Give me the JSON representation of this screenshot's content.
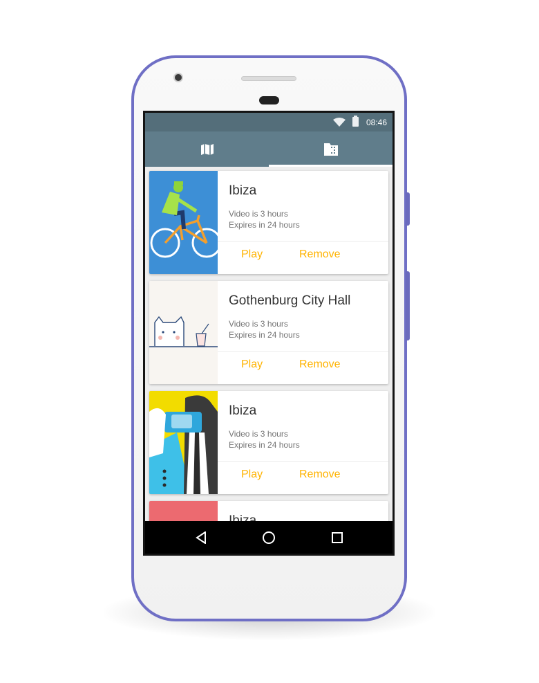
{
  "statusbar": {
    "time": "08:46",
    "wifi_icon": "wifi-icon",
    "battery_icon": "battery-icon"
  },
  "tabs": [
    {
      "icon": "map-icon",
      "selected": false
    },
    {
      "icon": "film-folder-icon",
      "selected": true
    }
  ],
  "cards": [
    {
      "title": "Ibiza",
      "line1": "Video is 3 hours",
      "line2": "Expires in 24 hours",
      "play_label": "Play",
      "remove_label": "Remove",
      "thumb": "cyclist-illustration",
      "thumb_color": "#3d8fd6"
    },
    {
      "title": "Gothenburg City Hall",
      "line1": "Video is 3 hours",
      "line2": "Expires in 24 hours",
      "play_label": "Play",
      "remove_label": "Remove",
      "thumb": "cat-illustration",
      "thumb_color": "#f8f5f1"
    },
    {
      "title": "Ibiza",
      "line1": "Video is 3 hours",
      "line2": "Expires in 24 hours",
      "play_label": "Play",
      "remove_label": "Remove",
      "thumb": "people-illustration",
      "thumb_color": "#f2dc00"
    },
    {
      "title": "Ibiza",
      "thumb": "pink-illustration",
      "thumb_color": "#ec6a70"
    }
  ],
  "navbar": {
    "back_icon": "back-icon",
    "home_icon": "home-icon",
    "recents_icon": "recents-icon"
  },
  "colors": {
    "appbar": "#607d8b",
    "statusbar": "#546e7a",
    "accent": "#ffb300",
    "phone_frame": "#6f6fc5"
  }
}
